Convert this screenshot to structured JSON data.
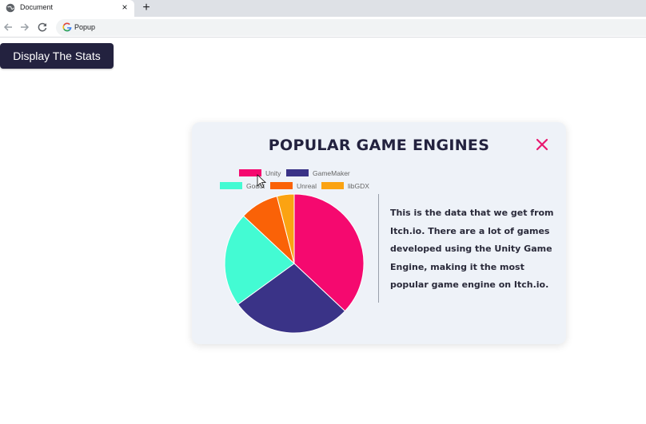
{
  "browser": {
    "tab_title": "Document",
    "tab_close": "×",
    "new_tab": "+",
    "url": "Popup"
  },
  "page": {
    "button_label": "Display The Stats"
  },
  "popup": {
    "title": "POPULAR GAME ENGINES",
    "description": "This is the data that we get from Itch.io. There are a lot of games developed using the Unity Game Engine, making it the most popular game engine on Itch.io.",
    "accent_color": "#e8186f"
  },
  "chart_data": {
    "type": "pie",
    "labels": [
      "Unity",
      "GameMaker",
      "Godot",
      "Unreal",
      "libGDX"
    ],
    "values": [
      37,
      28,
      22,
      9,
      4
    ],
    "colors": [
      "#f5096f",
      "#3a3387",
      "#43fbd3",
      "#fa6207",
      "#fba312"
    ],
    "legend_position": "top"
  }
}
